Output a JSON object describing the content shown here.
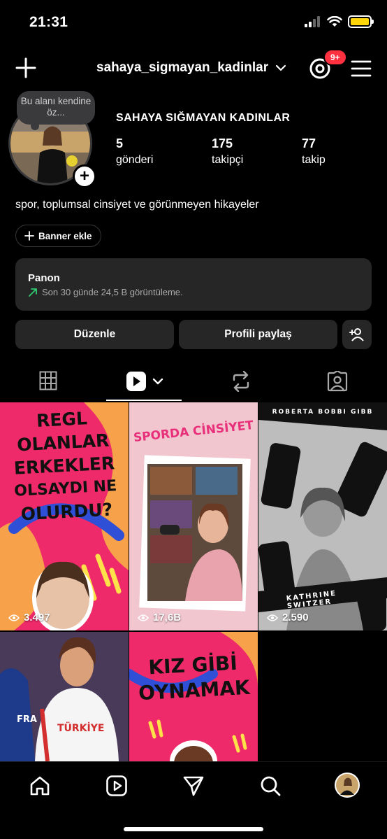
{
  "status_bar": {
    "time": "21:31"
  },
  "header": {
    "username": "sahaya_sigmayan_kadinlar",
    "notification_badge": "9+"
  },
  "profile": {
    "note": "Bu alanı kendine öz...",
    "full_name": "SAHAYA SIĞMAYAN KADINLAR",
    "stats": [
      {
        "value": "5",
        "label": "gönderi"
      },
      {
        "value": "175",
        "label": "takipçi"
      },
      {
        "value": "77",
        "label": "takip"
      }
    ],
    "bio": "spor, toplumsal cinsiyet ve görünmeyen hikayeler",
    "banner_button": "Banner ekle"
  },
  "dashboard": {
    "title": "Panon",
    "subtitle": "Son 30 günde 24,5 B görüntüleme."
  },
  "actions": {
    "edit": "Düzenle",
    "share": "Profili paylaş"
  },
  "posts": [
    {
      "text_lines": [
        "REGL",
        "OLANLAR",
        "ERKEKLER",
        "OLSAYDI NE",
        "OLURDU?"
      ],
      "views": "3.497",
      "bg": "#ef2a6a"
    },
    {
      "text_lines": [
        "SPORDA CİNSİYET"
      ],
      "views": "17,6B",
      "bg": "#f2c6cf"
    },
    {
      "text_lines": [
        "ROBERTA BOBBI GIBB",
        "KATHRINE SWITZER"
      ],
      "views": "2.590",
      "bg": "#bdbdbd"
    },
    {
      "text_lines": [
        "TÜRKİYE",
        "FRA"
      ],
      "views": "",
      "bg": "#3a4a8a"
    },
    {
      "text_lines": [
        "KIZ GİBİ",
        "OYNAMAK"
      ],
      "views": "",
      "bg": "#ef2a6a"
    }
  ],
  "colors": {
    "accent_badge": "#ff3040",
    "battery": "#ffd60a",
    "panel": "#262626",
    "trend_green": "#2ecc71"
  }
}
